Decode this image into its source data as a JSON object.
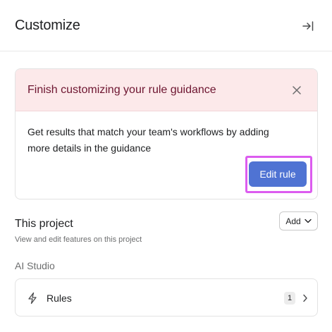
{
  "header": {
    "title": "Customize",
    "collapse_icon": "collapse-panel-icon"
  },
  "notice": {
    "title": "Finish customizing your rule guidance",
    "body": "Get results that match your team's workflows by adding more details in the guidance",
    "button_label": "Edit rule",
    "close_icon": "close-icon",
    "colors": {
      "header_bg": "#fce9ea",
      "title": "#6d1530",
      "button_bg": "#4f73d3",
      "highlight": "#dc5cef"
    }
  },
  "project": {
    "title": "This project",
    "subtitle": "View and edit features on this project",
    "add_label": "Add",
    "add_icon": "chevron-down-icon"
  },
  "ai_studio": {
    "label": "AI Studio",
    "items": [
      {
        "label": "Rules",
        "count": "1",
        "icon": "lightning-icon",
        "trailing_icon": "chevron-right-icon"
      }
    ]
  }
}
